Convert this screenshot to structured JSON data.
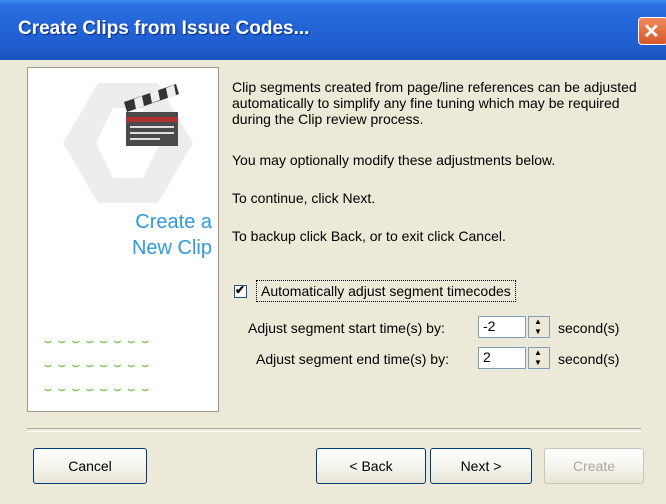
{
  "window": {
    "title": "Create Clips from Issue Codes..."
  },
  "side_panel": {
    "caption_line1": "Create a",
    "caption_line2": "New Clip"
  },
  "body": {
    "paragraph1": "Clip segments created from page/line references can be adjusted automatically to simplify any fine tuning which may be required during the Clip review process.",
    "paragraph2": "You may optionally modify these adjustments below.",
    "paragraph3": "To continue, click Next.",
    "paragraph4": "To backup click Back, or to exit click Cancel."
  },
  "auto_adjust": {
    "label": "Automatically adjust segment timecodes",
    "checked": true
  },
  "start_adjust": {
    "label": "Adjust segment start time(s) by:",
    "value": "-2",
    "unit": "second(s)"
  },
  "end_adjust": {
    "label": "Adjust segment end time(s) by:",
    "value": "2",
    "unit": "second(s)"
  },
  "buttons": {
    "cancel": "Cancel",
    "back": "< Back",
    "next": "Next >",
    "create": "Create"
  },
  "colors": {
    "title_bar": "#2263d6",
    "dialog_bg": "#ece9d8",
    "caption_blue": "#2f9ad8",
    "dots_green": "#7fc25a"
  },
  "icons": {
    "close": "close-icon",
    "clapperboard": "clapperboard-icon"
  }
}
